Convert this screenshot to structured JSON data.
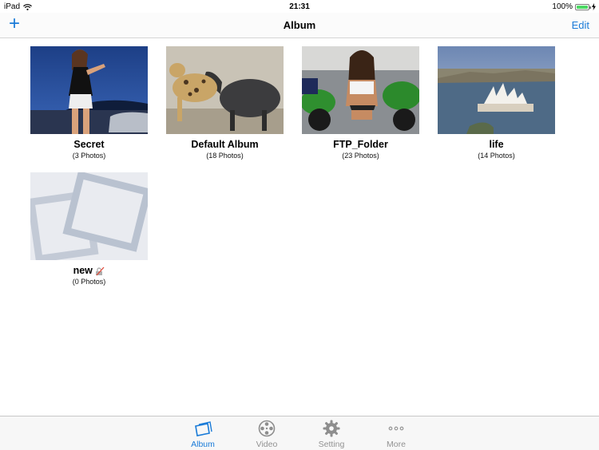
{
  "status": {
    "device": "iPad",
    "time": "21:31",
    "battery": "100%"
  },
  "nav": {
    "add_label": "+",
    "title": "Album",
    "edit_label": "Edit"
  },
  "albums": [
    {
      "name": "Secret",
      "count": "(3 Photos)"
    },
    {
      "name": "Default Album",
      "count": "(18 Photos)"
    },
    {
      "name": "FTP_Folder",
      "count": "(23 Photos)"
    },
    {
      "name": "life",
      "count": "(14 Photos)"
    },
    {
      "name": "new",
      "count": "(0 Photos)"
    }
  ],
  "tabs": [
    {
      "label": "Album",
      "icon": "album-icon",
      "active": true
    },
    {
      "label": "Video",
      "icon": "film-reel-icon"
    },
    {
      "label": "Setting",
      "icon": "gear-icon"
    },
    {
      "label": "More",
      "icon": "ellipsis-icon"
    }
  ],
  "colors": {
    "accent": "#1a7bd8",
    "inactive": "#929292",
    "battery": "#4cd964"
  }
}
